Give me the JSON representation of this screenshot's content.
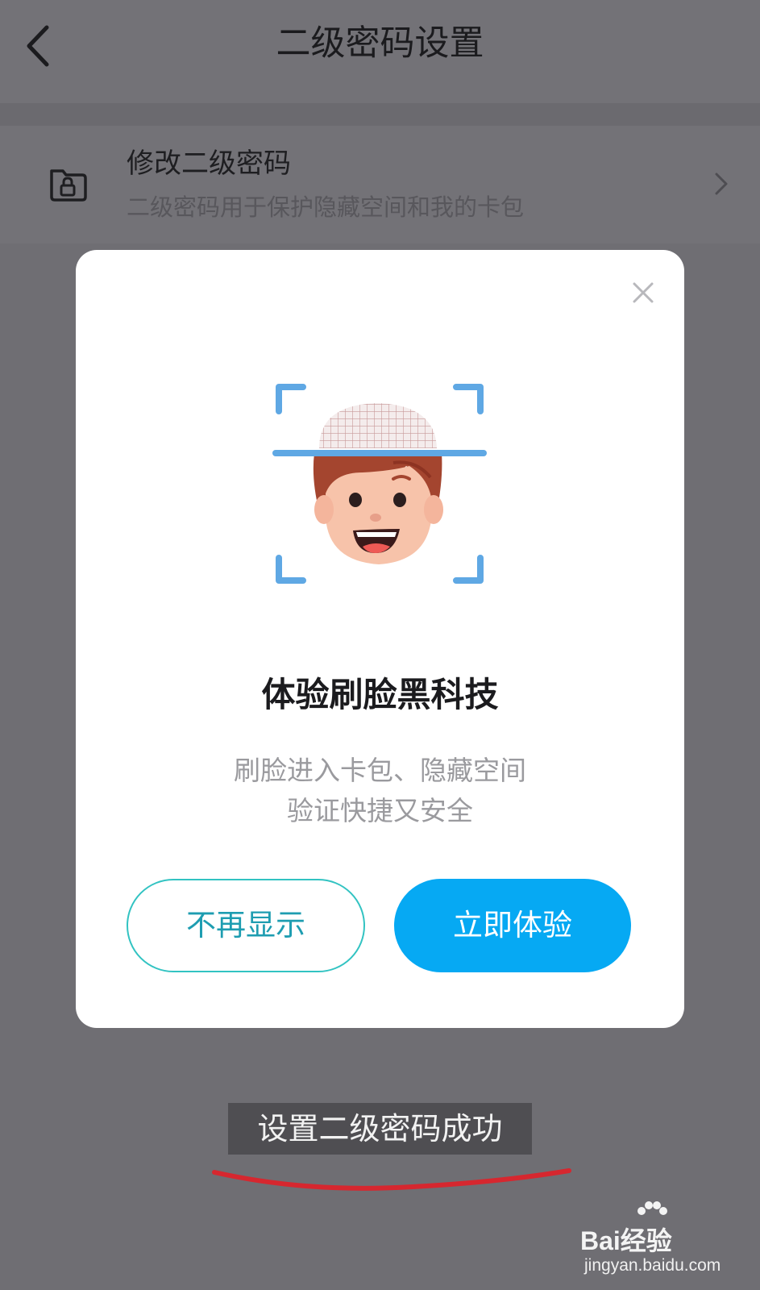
{
  "header": {
    "title": "二级密码设置",
    "back_icon": "chevron-left-icon"
  },
  "setting": {
    "icon": "lock-icon",
    "title": "修改二级密码",
    "subtitle": "二级密码用于保护隐藏空间和我的卡包",
    "chevron_icon": "chevron-right-icon"
  },
  "modal": {
    "close_icon": "close-icon",
    "illustration": "face-scan-illustration",
    "title": "体验刷脸黑科技",
    "desc_line1": "刷脸进入卡包、隐藏空间",
    "desc_line2": "验证快捷又安全",
    "dismiss_label": "不再显示",
    "try_label": "立即体验"
  },
  "toast": {
    "text": "设置二级密码成功"
  },
  "watermark": {
    "brand": "Bai经验",
    "url": "jingyan.baidu.com"
  },
  "colors": {
    "primary_button": "#06a9f3",
    "outline_button": "#32c3c2",
    "annotation_underline": "#d6272f",
    "overlay_background": "#6f6e73"
  }
}
